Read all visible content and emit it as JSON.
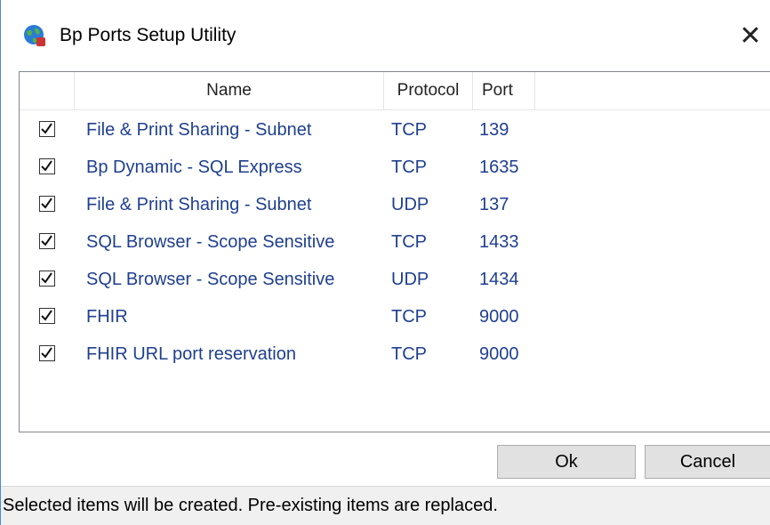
{
  "window": {
    "title": "Bp Ports Setup Utility",
    "icon": "globe-shield-icon",
    "close_label": "✕"
  },
  "list": {
    "columns": [
      "Name",
      "Protocol",
      "Port"
    ],
    "rows": [
      {
        "checked": true,
        "name": "File & Print Sharing - Subnet",
        "protocol": "TCP",
        "port": "139"
      },
      {
        "checked": true,
        "name": "Bp Dynamic - SQL Express",
        "protocol": "TCP",
        "port": "1635"
      },
      {
        "checked": true,
        "name": "File & Print Sharing - Subnet",
        "protocol": "UDP",
        "port": "137"
      },
      {
        "checked": true,
        "name": "SQL Browser - Scope Sensitive",
        "protocol": "TCP",
        "port": "1433"
      },
      {
        "checked": true,
        "name": "SQL Browser - Scope Sensitive",
        "protocol": "UDP",
        "port": "1434"
      },
      {
        "checked": true,
        "name": "FHIR",
        "protocol": "TCP",
        "port": "9000"
      },
      {
        "checked": true,
        "name": "FHIR URL port reservation",
        "protocol": "TCP",
        "port": "9000"
      }
    ]
  },
  "buttons": {
    "ok_label": "Ok",
    "cancel_label": "Cancel"
  },
  "status": {
    "text": "Selected items will be created. Pre-existing items are replaced."
  },
  "colors": {
    "row_text": "#1f3f8f",
    "window_border": "#4a8ad4"
  }
}
